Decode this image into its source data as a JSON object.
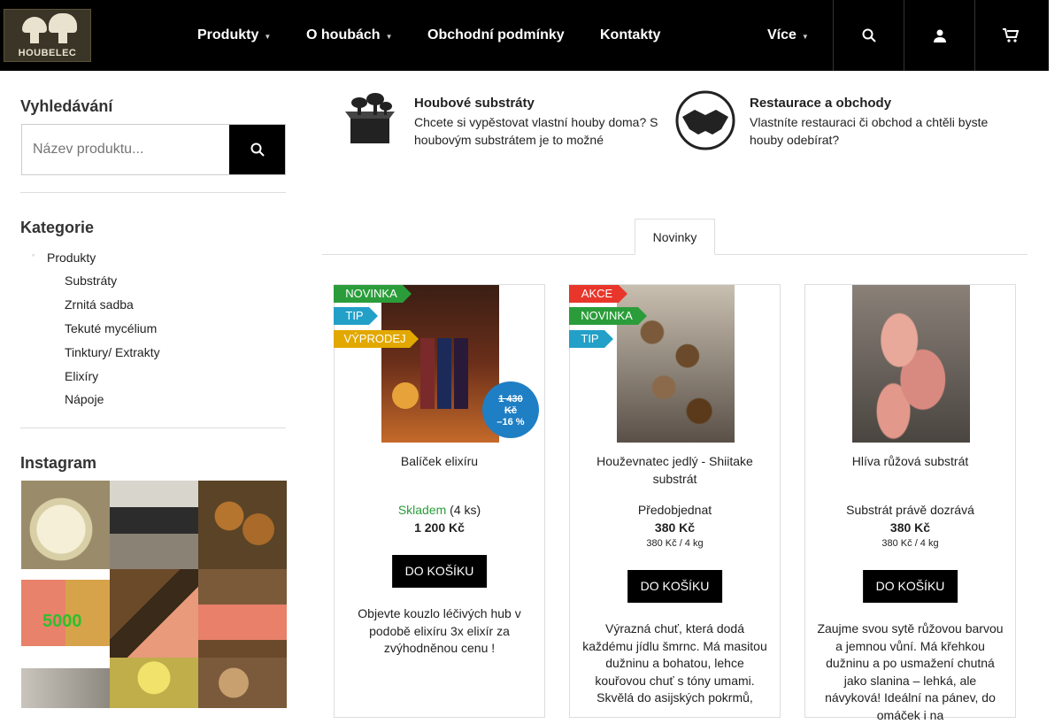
{
  "logo_text": "HOUBELEC",
  "nav": {
    "products": "Produkty",
    "about": "O houbách",
    "terms": "Obchodní podmínky",
    "contacts": "Kontakty",
    "more": "Více"
  },
  "sidebar": {
    "search_title": "Vyhledávání",
    "search_placeholder": "Název produktu...",
    "categories_title": "Kategorie",
    "categories": [
      "Produkty",
      "Substráty",
      "Zrnitá sadba",
      "Tekuté mycélium",
      "Tinktury/ Extrakty",
      "Elixíry",
      "Nápoje"
    ],
    "instagram_title": "Instagram",
    "instagram_text": "5000"
  },
  "features": [
    {
      "title": "Houbové substráty",
      "desc": "Chcete si vypěstovat vlastní houby doma? S houbovým substrátem je to možné",
      "icon": "substrate-box-icon"
    },
    {
      "title": "Restaurace a obchody",
      "desc": "Vlastníte restauraci či obchod a chtěli byste houby odebírat?",
      "icon": "handshake-icon"
    }
  ],
  "tab_label": "Novinky",
  "products": [
    {
      "flags": [
        "NOVINKA",
        "TIP",
        "VÝPRODEJ"
      ],
      "name": "Balíček elixíru",
      "avail_status": "Skladem",
      "avail_count": "(4 ks)",
      "price": "1 200 Kč",
      "old_price": "1 430 Kč",
      "discount": "–16 %",
      "unit": "",
      "cart": "DO KOŠÍKU",
      "desc": "Objevte kouzlo léčivých hub v podobě elixíru  3x elixír  za zvýhodněnou cenu !"
    },
    {
      "flags": [
        "AKCE",
        "NOVINKA",
        "TIP"
      ],
      "name": "Houževnatec jedlý - Shiitake substrát",
      "avail_status": "Předobjednat",
      "price": "380 Kč",
      "unit": "380 Kč / 4 kg",
      "cart": "DO KOŠÍKU",
      "desc": "Výrazná chuť, která dodá každému jídlu šmrnc. Má masitou dužninu a bohatou, lehce kouřovou chuť s tóny umami. Skvělá do asijských pokrmů,"
    },
    {
      "flags": [],
      "name": "Hlíva růžová substrát",
      "avail_status": "Substrát právě dozrává",
      "price": "380 Kč",
      "unit": "380 Kč / 4 kg",
      "cart": "DO KOŠÍKU",
      "desc": "Zaujme svou sytě růžovou barvou a jemnou vůní. Má křehkou dužninu a po usmažení chutná jako slanina – lehká, ale návyková! Ideální na pánev, do omáček i na"
    }
  ],
  "colors": {
    "novinka": "#2a9d3a",
    "tip": "#22a0c8",
    "vyprodej": "#e2a800",
    "akce": "#e8362b",
    "in_stock": "#2a9d3a",
    "discount": "#1f7fc4"
  }
}
